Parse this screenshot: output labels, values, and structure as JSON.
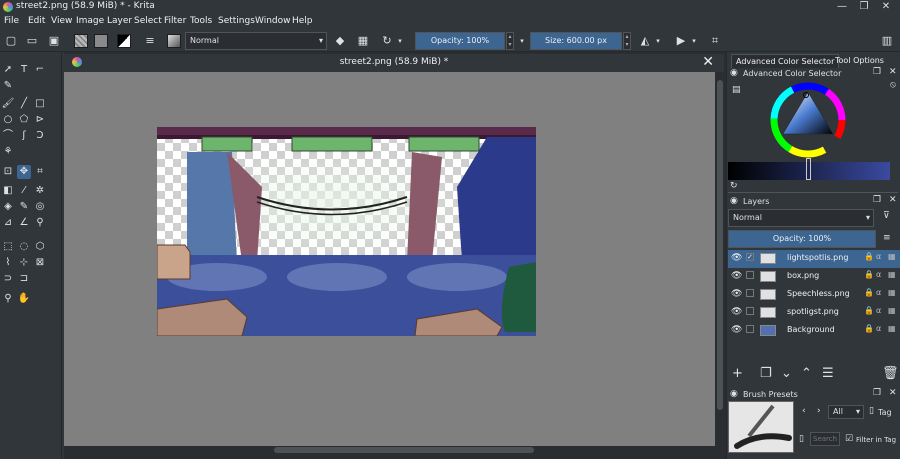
{
  "window": {
    "title": "street2.png (58.9 MiB) * - Krita",
    "controls": [
      "—",
      "❐",
      "✕"
    ]
  },
  "menu": [
    "File",
    "Edit",
    "View",
    "Image",
    "Layer",
    "Select",
    "Filter",
    "Tools",
    "Settings",
    "Window",
    "Help"
  ],
  "toolbar": {
    "blend_mode": "Normal",
    "opacity_label": "Opacity: 100%",
    "size_label": "Size: 600.00 px"
  },
  "document": {
    "tab_title": "street2.png (58.9 MiB) *",
    "close": "✕"
  },
  "dock": {
    "tabs": [
      "Advanced Color Selector",
      "Tool Options"
    ],
    "color_selector_title": "Advanced Color Selector",
    "layers_title": "Layers",
    "layers_blend_mode": "Normal",
    "layers_opacity": "Opacity:  100%",
    "layers": [
      {
        "name": "lightspotlis.png",
        "selected": true,
        "checked": true
      },
      {
        "name": "box.png",
        "selected": false,
        "checked": false
      },
      {
        "name": "Speechless.png",
        "selected": false,
        "checked": false
      },
      {
        "name": "spotligst.png",
        "selected": false,
        "checked": false
      },
      {
        "name": "Background",
        "selected": false,
        "checked": false
      }
    ],
    "brush_presets_title": "Brush Presets",
    "brush_filter": "All",
    "brush_tag_label": "Tag",
    "search_placeholder": "Search",
    "filter_in_tag_label": "Filter in Tag"
  },
  "colors": {
    "accent": "#3c6592",
    "panel": "#31363b",
    "canvas_bg": "#808080"
  }
}
